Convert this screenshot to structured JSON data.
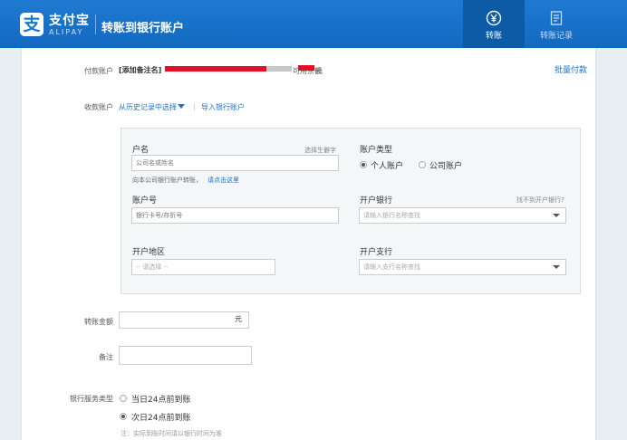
{
  "header": {
    "logo_glyph": "支",
    "logo_cn": "支付宝",
    "logo_en": "ALIPAY",
    "title": "转账到银行账户",
    "tabs": [
      {
        "label": "转账",
        "icon": "yuan-circle-icon",
        "active": true
      },
      {
        "label": "转账记录",
        "icon": "document-list-icon",
        "active": false
      }
    ]
  },
  "payer": {
    "label": "付款账户",
    "note_link": "[添加备注名]",
    "balance_prefix": "可用余额",
    "balance_suffix": "元",
    "batch_link": "批量付款"
  },
  "payee": {
    "label": "收款账户",
    "history_link": "从历史记录中选择",
    "import_link": "导入银行账户"
  },
  "form": {
    "name_label": "户名",
    "name_hint": "选择生僻字",
    "name_placeholder": "公司名或姓名",
    "company_note": "向本公司银行账户转账，",
    "company_link": "请点击这里",
    "account_type_label": "账户类型",
    "account_types": [
      "个人账户",
      "公司账户"
    ],
    "account_no_label": "账户号",
    "account_no_placeholder": "银行卡号/存折号",
    "bank_label": "开户银行",
    "bank_hint": "找不到开户银行?",
    "bank_placeholder": "请输入银行名称查找",
    "region_label": "开户地区",
    "region_placeholder": "-- 请选择 --",
    "branch_label": "开户支行",
    "branch_placeholder": "请输入支行名称查找"
  },
  "amount": {
    "label": "转账金额",
    "unit": "元"
  },
  "remark": {
    "label": "备注"
  },
  "service": {
    "label": "银行服务类型",
    "options": [
      "当日24点前到账",
      "次日24点前到账"
    ],
    "selected_index": 1,
    "note": "注：实际到账时间请以银行时间为准"
  },
  "colors": {
    "header_blue": "#1672cc",
    "active_tab": "#0d5aa7",
    "link": "#1a73c7",
    "redaction": "#e0102a"
  }
}
